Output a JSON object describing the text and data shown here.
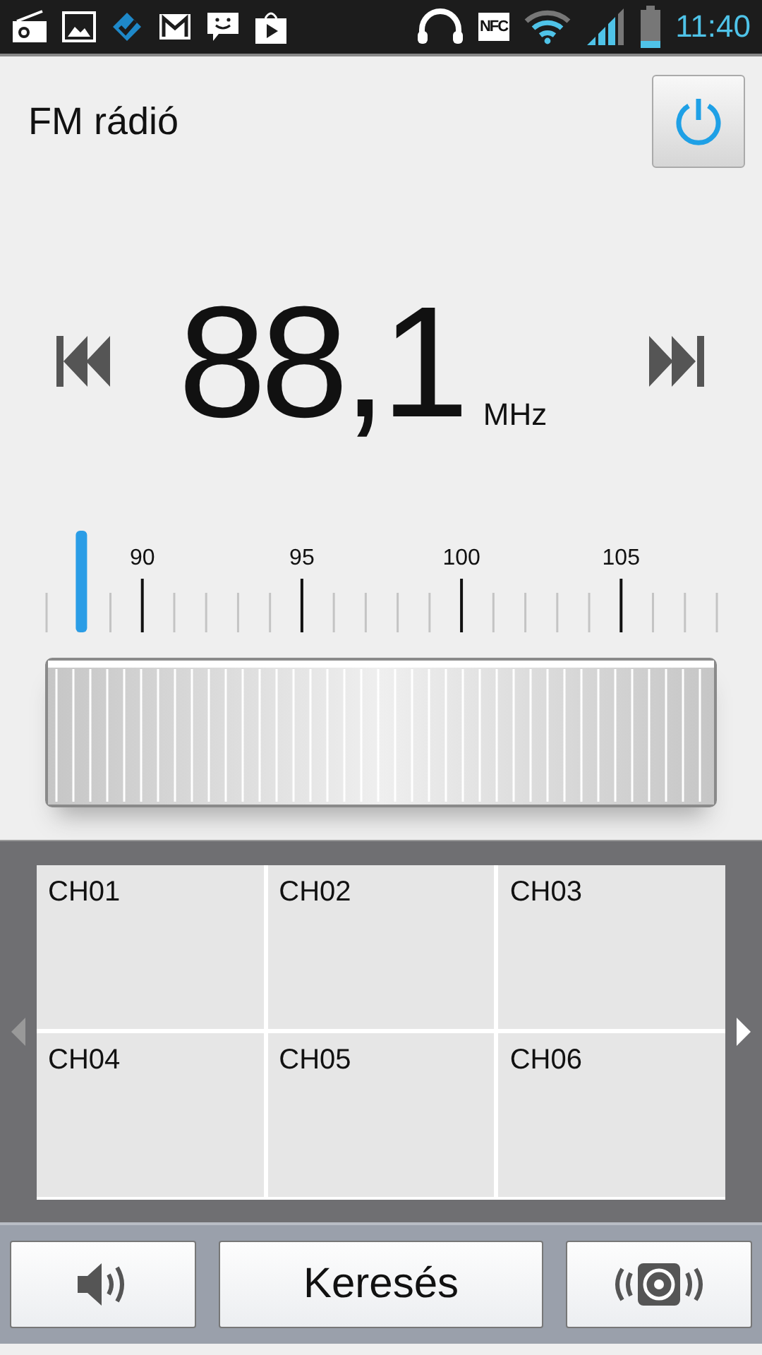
{
  "status_bar": {
    "nfc_label": "NFC",
    "time": "11:40"
  },
  "header": {
    "title": "FM rádió",
    "power_on": true
  },
  "tuner": {
    "frequency": "88,1",
    "unit": "MHz",
    "scale_labels": [
      "90",
      "95",
      "100",
      "105"
    ],
    "level": 0.052
  },
  "presets": {
    "left_arrow_disabled": true,
    "right_arrow_disabled": false,
    "channels": [
      {
        "label": "CH01"
      },
      {
        "label": "CH02"
      },
      {
        "label": "CH03"
      },
      {
        "label": "CH04"
      },
      {
        "label": "CH05"
      },
      {
        "label": "CH06"
      }
    ]
  },
  "bottom_bar": {
    "search_label": "Keresés"
  }
}
